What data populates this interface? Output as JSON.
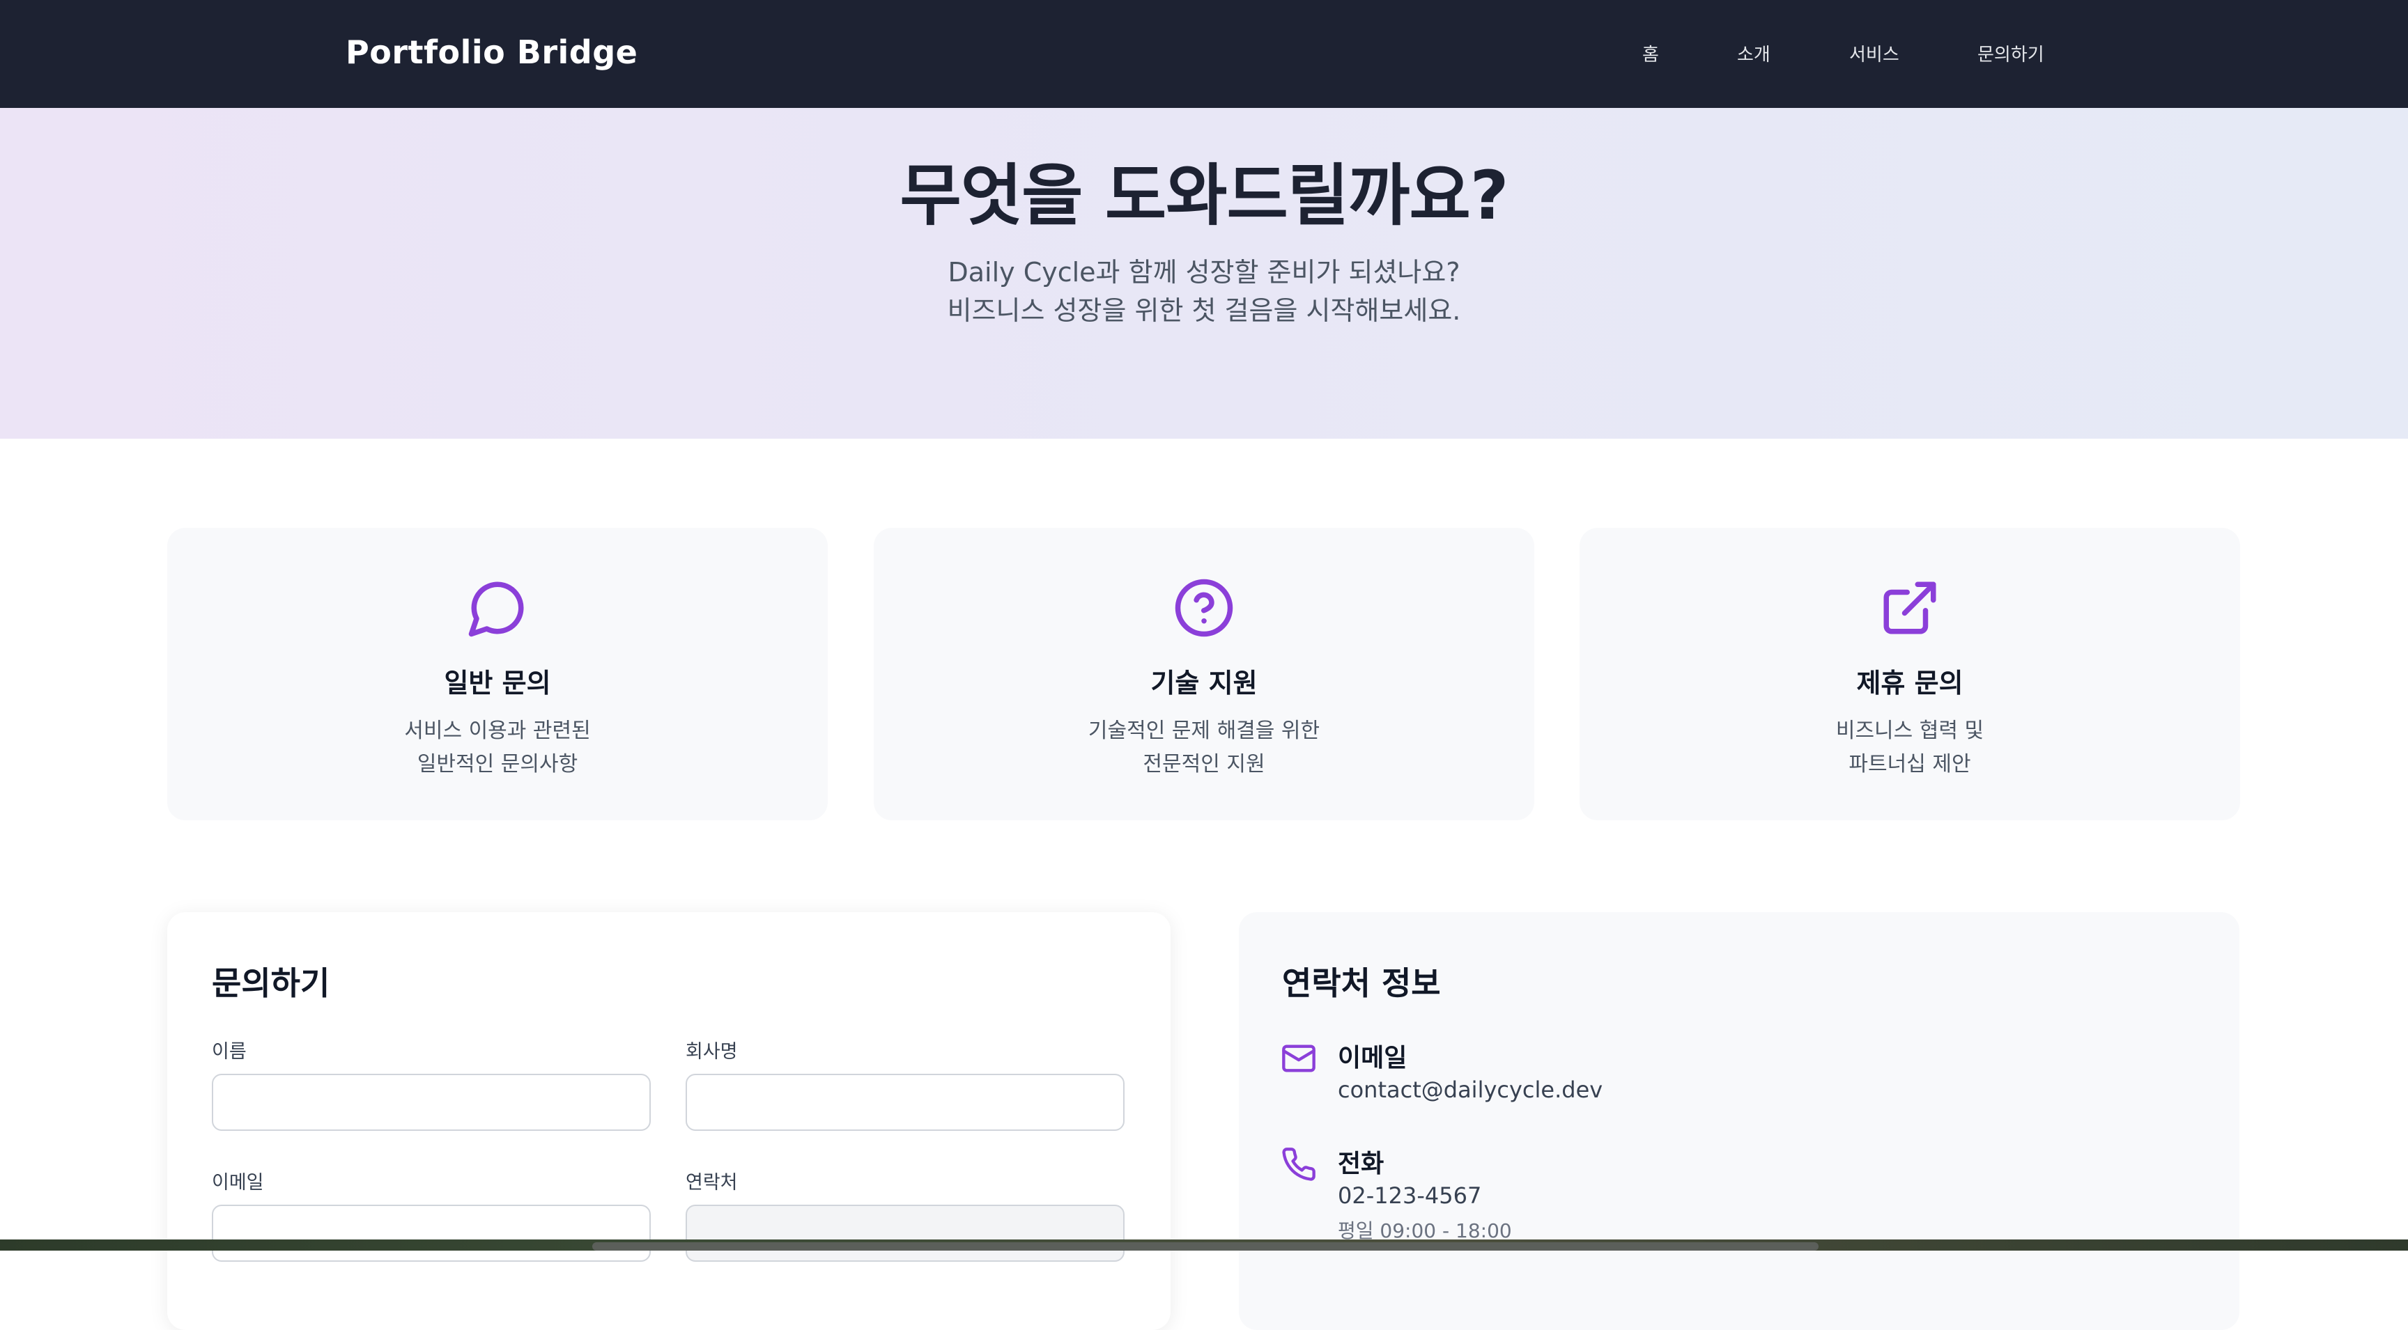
{
  "nav": {
    "brand": "Portfolio Bridge",
    "items": [
      {
        "label": "홈"
      },
      {
        "label": "소개"
      },
      {
        "label": "서비스"
      },
      {
        "label": "문의하기"
      }
    ]
  },
  "hero": {
    "title": "무엇을 도와드릴까요?",
    "line1": "Daily Cycle과 함께 성장할 준비가 되셨나요?",
    "line2": "비즈니스 성장을 위한 첫 걸음을 시작해보세요."
  },
  "cards": [
    {
      "icon": "chat-bubble-icon",
      "title": "일반 문의",
      "line1": "서비스 이용과 관련된",
      "line2": "일반적인 문의사항"
    },
    {
      "icon": "question-circle-icon",
      "title": "기술 지원",
      "line1": "기술적인 문제 해결을 위한",
      "line2": "전문적인 지원"
    },
    {
      "icon": "external-link-icon",
      "title": "제휴 문의",
      "line1": "비즈니스 협력 및",
      "line2": "파트너십 제안"
    }
  ],
  "form": {
    "title": "문의하기",
    "name_label": "이름",
    "company_label": "회사명",
    "email_label": "이메일",
    "phone_label": "연락처",
    "name_value": "",
    "company_value": "",
    "email_value": "",
    "phone_value": ""
  },
  "contact": {
    "title": "연락처 정보",
    "email_heading": "이메일",
    "email_value": "contact@dailycycle.dev",
    "phone_heading": "전화",
    "phone_value": "02-123-4567",
    "phone_hours": "평일 09:00 - 18:00"
  },
  "colors": {
    "accent": "#8b3fd9",
    "nav_bg": "#1d2232"
  }
}
